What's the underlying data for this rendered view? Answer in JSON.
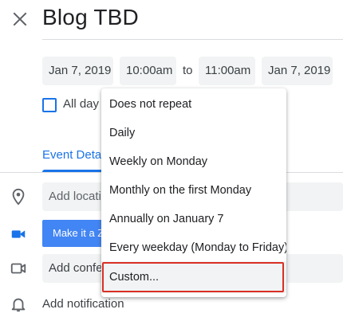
{
  "header": {
    "title": "Blog TBD"
  },
  "datetime": {
    "start_date": "Jan 7, 2019",
    "start_time": "10:00am",
    "to_label": "to",
    "end_time": "11:00am",
    "end_date": "Jan 7, 2019"
  },
  "all_day": {
    "label": "All day",
    "checked": false
  },
  "tabs": {
    "event_details": "Event Details"
  },
  "fields": {
    "location_placeholder": "Add location",
    "zoom_button": "Make it a Zoom Meeting",
    "conference": "Add conferencing",
    "notification": "Add notification"
  },
  "recurrence_menu": {
    "options": [
      "Does not repeat",
      "Daily",
      "Weekly on Monday",
      "Monthly on the first Monday",
      "Annually on January 7",
      "Every weekday (Monday to Friday)",
      "Custom..."
    ],
    "highlighted": "Custom..."
  },
  "colors": {
    "accent": "#1a73e8",
    "zoom": "#4285f4",
    "highlight_border": "#d93025",
    "chip_bg": "#f1f3f4"
  },
  "icons": [
    "close-icon",
    "location-pin-icon",
    "video-icon",
    "video-camera-outline-icon",
    "bell-icon"
  ]
}
